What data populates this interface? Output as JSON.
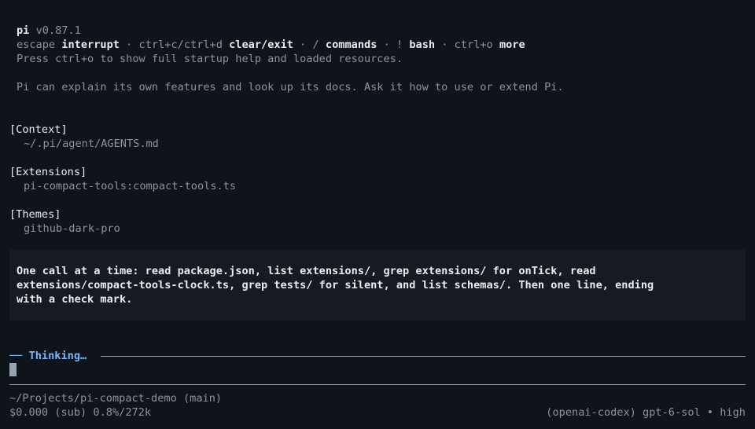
{
  "header": {
    "app_name": "pi",
    "version": "v0.87.1",
    "hints": [
      {
        "key": "escape",
        "action": "interrupt"
      },
      {
        "key": "ctrl+c/ctrl+d",
        "action": "clear/exit"
      },
      {
        "key": "/",
        "action": "commands"
      },
      {
        "key": "!",
        "action": "bash"
      },
      {
        "key": "ctrl+o",
        "action": "more"
      }
    ],
    "separator": " · ",
    "startup_hint": "Press ctrl+o to show full startup help and loaded resources.",
    "tip": "Pi can explain its own features and look up its docs. Ask it how to use or extend Pi."
  },
  "sections": {
    "context": {
      "title": "[Context]",
      "items": [
        "~/.pi/agent/AGENTS.md"
      ]
    },
    "extensions": {
      "title": "[Extensions]",
      "items": [
        "pi-compact-tools:compact-tools.ts"
      ]
    },
    "themes": {
      "title": "[Themes]",
      "items": [
        "github-dark-pro"
      ]
    }
  },
  "user_message": {
    "lines": [
      "One call at a time: read package.json, list extensions/, grep extensions/ for onTick, read",
      "extensions/compact-tools-clock.ts, grep tests/ for silent, and list schemas/. Then one line, ending",
      "with a check mark."
    ]
  },
  "status": {
    "thinking_label": "Thinking…",
    "thinking_prefix": "── "
  },
  "footer": {
    "path": "~/Projects/pi-compact-demo (main)",
    "cost": "$0.000 (sub) 0.8%/272k",
    "model": "(openai-codex) gpt-6-sol • high"
  },
  "colors": {
    "background": "#0f131a",
    "accent": "#79b8ff",
    "rule": "#6e9ef0",
    "message_bg": "#161b22"
  }
}
